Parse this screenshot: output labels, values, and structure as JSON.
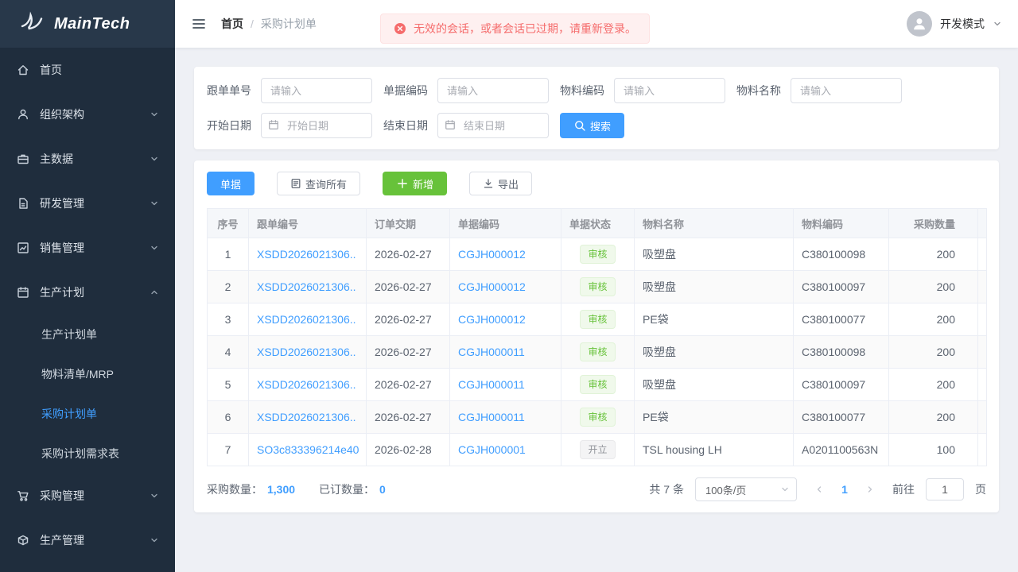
{
  "brand": {
    "name": "MainTech"
  },
  "colors": {
    "accent": "#409eff",
    "success": "#67c23a",
    "danger": "#f56c6c",
    "sidebar": "#1f2d3d"
  },
  "sidebar": {
    "items": [
      {
        "id": "home",
        "label": "首页",
        "icon": "home",
        "expandable": false
      },
      {
        "id": "org",
        "label": "组织架构",
        "icon": "user",
        "expandable": true
      },
      {
        "id": "master-data",
        "label": "主数据",
        "icon": "briefcase",
        "expandable": true
      },
      {
        "id": "rd-mgmt",
        "label": "研发管理",
        "icon": "document",
        "expandable": true
      },
      {
        "id": "sales-mgmt",
        "label": "销售管理",
        "icon": "chart",
        "expandable": true
      },
      {
        "id": "production-plan",
        "label": "生产计划",
        "icon": "calendar",
        "expandable": true,
        "expanded": true,
        "children": [
          {
            "label": "生产计划单",
            "active": false
          },
          {
            "label": "物料清单/MRP",
            "active": false
          },
          {
            "label": "采购计划单",
            "active": true
          },
          {
            "label": "采购计划需求表",
            "active": false
          }
        ]
      },
      {
        "id": "purchase-mgmt",
        "label": "采购管理",
        "icon": "cart",
        "expandable": true
      },
      {
        "id": "production-mgmt",
        "label": "生产管理",
        "icon": "box",
        "expandable": true
      }
    ]
  },
  "header": {
    "breadcrumb_home": "首页",
    "breadcrumb_separator": "/",
    "breadcrumb_current": "采购计划单",
    "toast": "无效的会话，或者会话已过期，请重新登录。",
    "user_mode": "开发模式"
  },
  "filters": {
    "fields": [
      {
        "label": "跟单单号",
        "placeholder": "请输入",
        "type": "text"
      },
      {
        "label": "单据编码",
        "placeholder": "请输入",
        "type": "text"
      },
      {
        "label": "物料编码",
        "placeholder": "请输入",
        "type": "text"
      },
      {
        "label": "物料名称",
        "placeholder": "请输入",
        "type": "text"
      },
      {
        "label": "开始日期",
        "placeholder": "开始日期",
        "type": "date"
      },
      {
        "label": "结束日期",
        "placeholder": "结束日期",
        "type": "date"
      }
    ],
    "search_label": "搜索"
  },
  "toolbar": {
    "document_button": "单据",
    "query_all": "查询所有",
    "add": "新增",
    "export": "导出"
  },
  "table": {
    "columns": [
      "序号",
      "跟单编号",
      "订单交期",
      "单据编码",
      "单据状态",
      "物料名称",
      "物料编码",
      "采购数量"
    ],
    "rows": [
      {
        "seq": "1",
        "follow_no": "XSDD2026021306..",
        "delivery": "2026-02-27",
        "doc_no": "CGJH000012",
        "status": "审核",
        "status_type": "success",
        "material_name": "吸塑盘",
        "material_code": "C380100098",
        "qty": "200"
      },
      {
        "seq": "2",
        "follow_no": "XSDD2026021306..",
        "delivery": "2026-02-27",
        "doc_no": "CGJH000012",
        "status": "审核",
        "status_type": "success",
        "material_name": "吸塑盘",
        "material_code": "C380100097",
        "qty": "200"
      },
      {
        "seq": "3",
        "follow_no": "XSDD2026021306..",
        "delivery": "2026-02-27",
        "doc_no": "CGJH000012",
        "status": "审核",
        "status_type": "success",
        "material_name": "PE袋",
        "material_code": "C380100077",
        "qty": "200"
      },
      {
        "seq": "4",
        "follow_no": "XSDD2026021306..",
        "delivery": "2026-02-27",
        "doc_no": "CGJH000011",
        "status": "审核",
        "status_type": "success",
        "material_name": "吸塑盘",
        "material_code": "C380100098",
        "qty": "200"
      },
      {
        "seq": "5",
        "follow_no": "XSDD2026021306..",
        "delivery": "2026-02-27",
        "doc_no": "CGJH000011",
        "status": "审核",
        "status_type": "success",
        "material_name": "吸塑盘",
        "material_code": "C380100097",
        "qty": "200"
      },
      {
        "seq": "6",
        "follow_no": "XSDD2026021306..",
        "delivery": "2026-02-27",
        "doc_no": "CGJH000011",
        "status": "审核",
        "status_type": "success",
        "material_name": "PE袋",
        "material_code": "C380100077",
        "qty": "200"
      },
      {
        "seq": "7",
        "follow_no": "SO3c833396214e40",
        "delivery": "2026-02-28",
        "doc_no": "CGJH000001",
        "status": "开立",
        "status_type": "info",
        "material_name": "TSL housing LH",
        "material_code": "A0201100563N",
        "qty": "100"
      }
    ]
  },
  "footer": {
    "purchase_qty_label": "采购数量：",
    "purchase_qty": "1,300",
    "ordered_qty_label": "已订数量：",
    "ordered_qty": "0",
    "total": "共 7 条",
    "page_size": "100条/页",
    "page": "1",
    "goto_label": "前往",
    "goto_value": "1",
    "page_unit": "页"
  }
}
